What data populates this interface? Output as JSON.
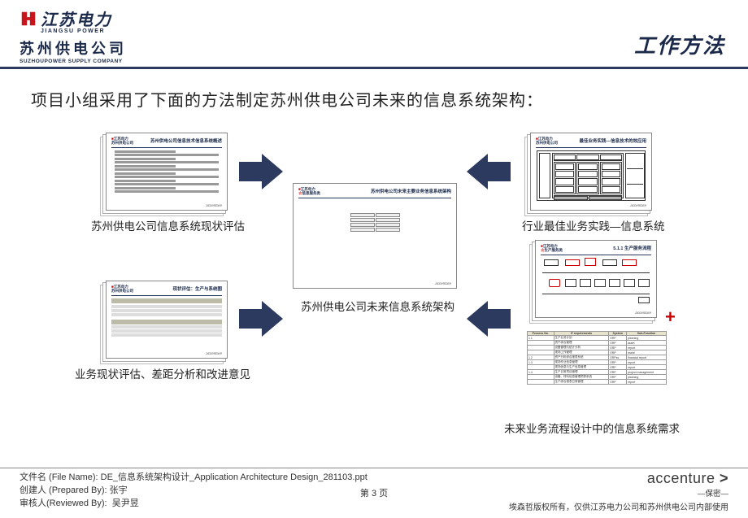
{
  "logo": {
    "brand_cn": "江苏电力",
    "brand_en": "JIANGSU POWER",
    "company_cn": "苏州供电公司",
    "company_en": "SUZHOUPOWER SUPPLY COMPANY"
  },
  "page_title": "工作方法",
  "intro": "项目小组采用了下面的方法制定苏州供电公司未来的信息系统架构：",
  "captions": {
    "top_left": "苏州供电公司信息系统现状评估",
    "bottom_left": "业务现状评估、差距分析和改进意见",
    "center": "苏州供电公司未来信息系统架构",
    "top_right": "行业最佳业务实践—信息系统",
    "bottom_right": "未来业务流程设计中的信息系统需求"
  },
  "thumbs": {
    "top_left_title": "苏州供电公司信息技术信息系统概述",
    "bottom_left_title": "现状评估：生产与系统图",
    "center_title": "苏州供电公司未来主要业务信息系统架构",
    "top_right_title": "最佳业务实践—信息技术的效应用",
    "flow_title": "5.1.1 生产服务流程",
    "acc": "accenture"
  },
  "table": {
    "headers": [
      "Process No.",
      "IT requirements",
      "System",
      "Sub-Function"
    ],
    "rows": [
      [
        "1.1",
        "生产业务计划",
        "ERP",
        "planning"
      ],
      [
        "",
        "资产综合管理",
        "ERP",
        "asset"
      ],
      [
        "",
        "设备管理与统计分析",
        "ERP",
        "report"
      ],
      [
        "",
        "现场工作管理",
        "ERP",
        "maint"
      ],
      [
        "1.2",
        "资产分析综合报表系统",
        "ERPss",
        "financial report"
      ],
      [
        "1.3",
        "现场作业信息管理",
        "ERP",
        "report"
      ],
      [
        "",
        "现场信息与生产信息管理",
        "ERP",
        "report"
      ],
      [
        "1.4",
        "生产日常项目管理",
        "ERP",
        "project management"
      ],
      [
        "",
        "设备、材料信息管理预算系统",
        "ERP",
        "planning"
      ],
      [
        "",
        "生产综合报表日常管理",
        "ERP",
        "report"
      ]
    ]
  },
  "footer": {
    "file_label": "文件名 (File Name):",
    "file_value": "DE_信息系统架构设计_Application Architecture Design_281103.ppt",
    "creator_label": "创建人 (Prepared By):",
    "creator_value": "张宇",
    "reviewer_label": "审核人(Reviewed By):",
    "reviewer_value": "吴尹昱",
    "page": "第 3 页",
    "acc_brand": "accenture",
    "acc_tag": "—保密—",
    "copyright": "埃森哲版权所有，仅供江苏电力公司和苏州供电公司内部使用"
  }
}
